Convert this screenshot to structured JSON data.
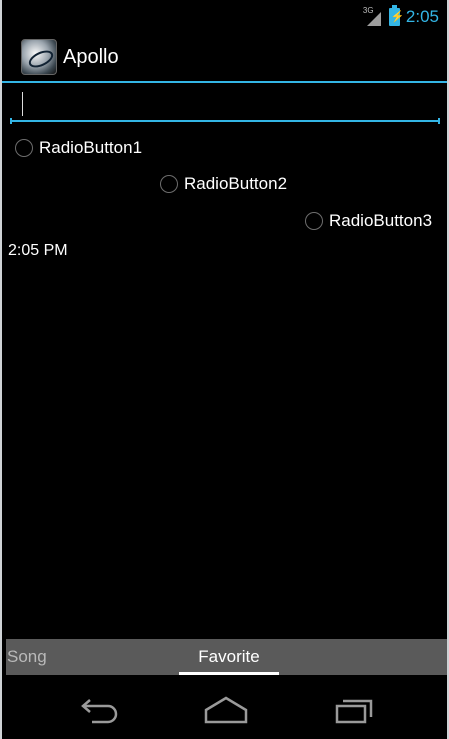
{
  "status": {
    "network": "3G",
    "time": "2:05"
  },
  "app": {
    "title": "Apollo",
    "icon": "apollo-app-icon"
  },
  "input": {
    "value": "",
    "placeholder": ""
  },
  "radios": [
    {
      "label": "RadioButton1",
      "checked": false
    },
    {
      "label": "RadioButton2",
      "checked": false
    },
    {
      "label": "RadioButton3",
      "checked": false
    }
  ],
  "clock_text": "2:05 PM",
  "tabs": [
    {
      "label": "Song",
      "selected": false
    },
    {
      "label": "Favorite",
      "selected": true
    }
  ],
  "navigation": {
    "back_icon": "back-icon",
    "home_icon": "home-icon",
    "recents_icon": "recents-icon"
  },
  "colors": {
    "accent": "#33b5e5",
    "background": "#000000",
    "tab_bar": "#5a5a5a"
  }
}
